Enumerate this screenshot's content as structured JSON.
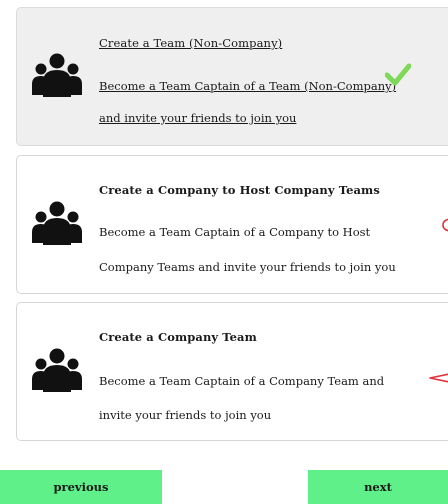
{
  "options": [
    {
      "title": "Create a Team (Non-Company)",
      "description_lines": [
        "Become a Team Captain of a Team (Non-Company)",
        "and invite your friends to join you"
      ],
      "selected": true,
      "icon": "group-icon"
    },
    {
      "title": "Create a Company to Host Company Teams",
      "description_lines": [
        "Become a Team Captain of a Company to Host",
        "Company Teams and invite your friends to join you"
      ],
      "selected": false,
      "icon": "group-icon"
    },
    {
      "title": "Create a Company Team",
      "description_lines": [
        "Become a Team Captain of a Company Team and",
        "invite your friends to join you"
      ],
      "selected": false,
      "icon": "group-icon"
    }
  ],
  "selected_indicator": "checkmark-icon",
  "nav": {
    "previous_label": "previous",
    "next_label": "next"
  },
  "colors": {
    "accent_green": "#5ff08a",
    "check_green": "#7ed957",
    "selected_bg": "#efefef",
    "edge_mark_red": "#e0303a"
  }
}
